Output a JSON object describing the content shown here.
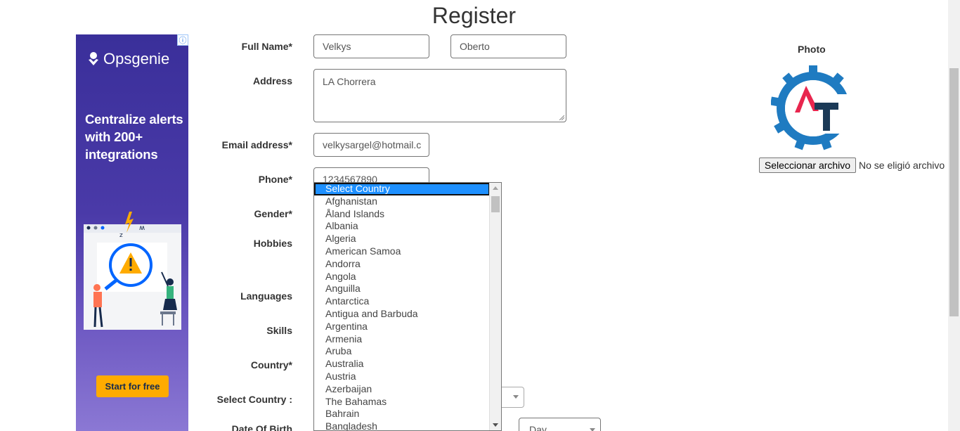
{
  "title": "Register",
  "ad": {
    "info_glyph": "ⓘ",
    "brand": "Opsgenie",
    "headline": "Centralize alerts with 200+ integrations",
    "cta": "Start for free"
  },
  "labels": {
    "full_name": "Full Name*",
    "address": "Address",
    "email": "Email address*",
    "phone": "Phone*",
    "gender": "Gender*",
    "hobbies": "Hobbies",
    "languages": "Languages",
    "skills": "Skills",
    "country": "Country*",
    "select_country": "Select Country :",
    "dob": "Date Of Birth"
  },
  "fields": {
    "first_name": "Velkys",
    "last_name": "Oberto",
    "address": "LA Chorrera",
    "email": "velkysargel@hotmail.c",
    "phone": "1234567890",
    "dob_day": "Day"
  },
  "country_dropdown": {
    "options": [
      "Select Country",
      "Afghanistan",
      "Åland Islands",
      "Albania",
      "Algeria",
      "American Samoa",
      "Andorra",
      "Angola",
      "Anguilla",
      "Antarctica",
      "Antigua and Barbuda",
      "Argentina",
      "Armenia",
      "Aruba",
      "Australia",
      "Austria",
      "Azerbaijan",
      "The Bahamas",
      "Bahrain",
      "Bangladesh"
    ],
    "selected": "Select Country"
  },
  "photo": {
    "label": "Photo",
    "button": "Seleccionar archivo",
    "status": "No se eligió archivo"
  },
  "colors": {
    "ad_cta": "#ffab00",
    "selection": "#1e90ff",
    "logo_gear": "#1f7bc1",
    "logo_a": "#e8264e",
    "logo_t": "#1b3a57"
  }
}
